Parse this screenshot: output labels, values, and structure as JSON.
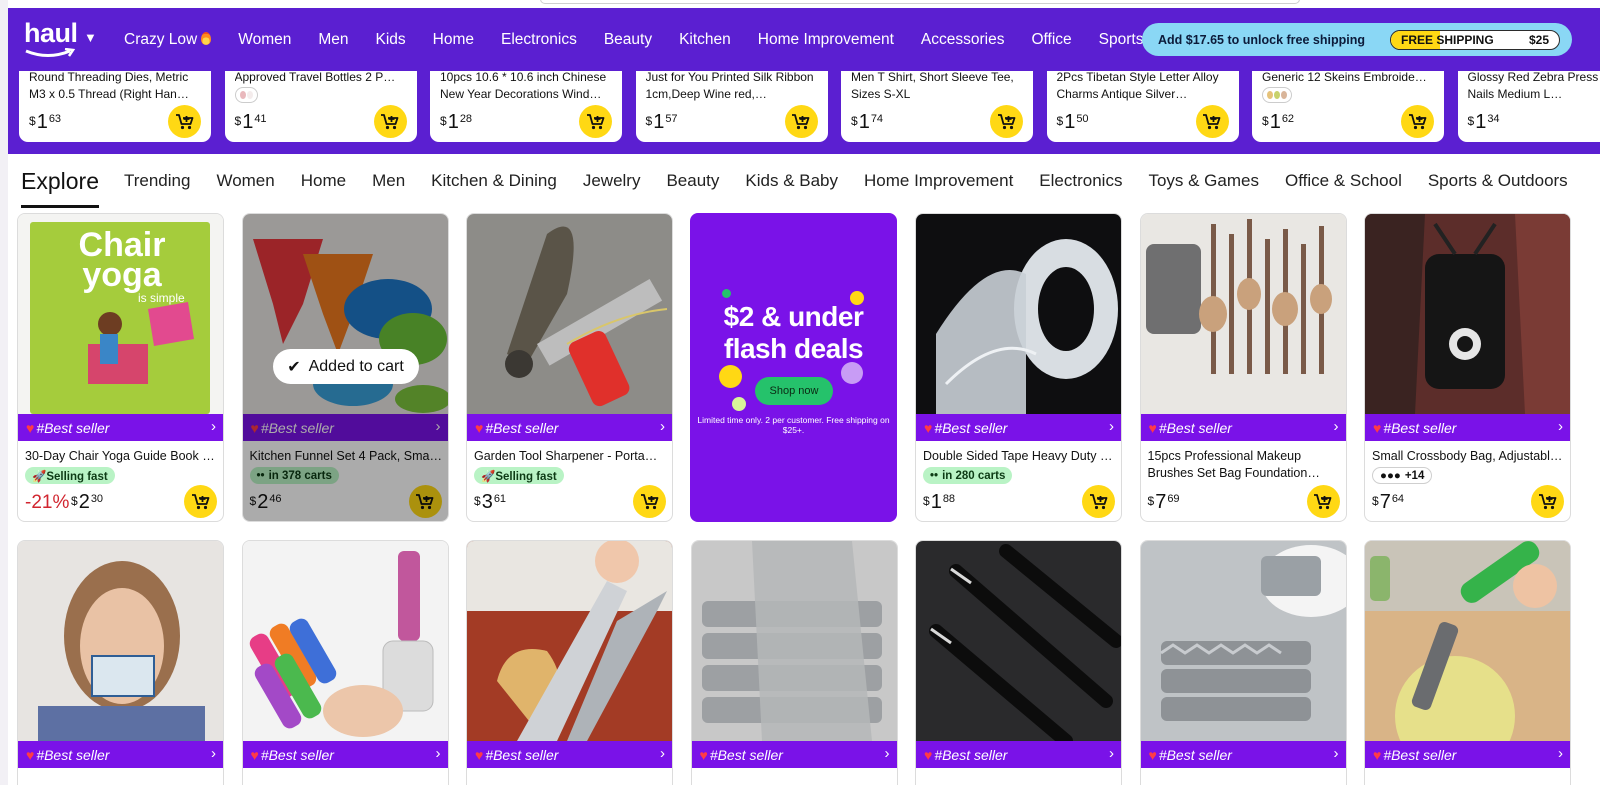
{
  "header": {
    "logo": "haul",
    "nav": [
      "Crazy Low",
      "Women",
      "Men",
      "Kids",
      "Home",
      "Electronics",
      "Beauty",
      "Kitchen",
      "Home Improvement",
      "Accessories",
      "Office",
      "Sports"
    ],
    "shipping": {
      "message": "Add $17.65 to unlock free shipping",
      "label": "FREE SHIPPING",
      "threshold": "$25",
      "progress_fraction": 0.29
    }
  },
  "carousel": [
    {
      "title": "Round Threading Dies, Metric M3 x 0.5 Thread (Right Han…",
      "dollars": "1",
      "cents": "63",
      "swatches": []
    },
    {
      "title": "Approved Travel Bottles 2 P…",
      "dollars": "1",
      "cents": "41",
      "swatches": [
        "#e9b8bc",
        "#f4ecec"
      ]
    },
    {
      "title": "10pcs 10.6 * 10.6 inch Chinese New Year Decorations Wind…",
      "dollars": "1",
      "cents": "28",
      "swatches": []
    },
    {
      "title": "Just for You Printed Silk Ribbon 1cm,Deep Wine red,…",
      "dollars": "1",
      "cents": "57",
      "swatches": []
    },
    {
      "title": "Men T Shirt, Short Sleeve Tee, Sizes S-XL",
      "dollars": "1",
      "cents": "74",
      "swatches": []
    },
    {
      "title": "2Pcs Tibetan Style Letter Alloy Charms Antique Silver…",
      "dollars": "1",
      "cents": "50",
      "swatches": []
    },
    {
      "title": "Generic 12 Skeins Embroide…",
      "dollars": "1",
      "cents": "62",
      "swatches": [
        "#e6c27a",
        "#c8d26b",
        "#d9b59a"
      ]
    },
    {
      "title": "Glossy Red Zebra Press on Nails Medium L…",
      "dollars": "1",
      "cents": "34",
      "swatches": []
    }
  ],
  "tabs": [
    "Explore",
    "Trending",
    "Women",
    "Home",
    "Men",
    "Kitchen & Dining",
    "Jewelry",
    "Beauty",
    "Kids & Baby",
    "Home Improvement",
    "Electronics",
    "Toys & Games",
    "Office & School",
    "Sports & Outdoors"
  ],
  "badge_label": "#Best seller",
  "products": [
    {
      "title": "30-Day Chair Yoga Guide Book …",
      "chip": "🚀Selling fast",
      "chip_type": "fast",
      "discount": "-21%",
      "dollars": "2",
      "cents": "30",
      "img": "book"
    },
    {
      "title": "Kitchen Funnel Set 4 Pack, Sma…",
      "chip": "in 378 carts",
      "chip_type": "carts",
      "discount": "",
      "dollars": "2",
      "cents": "46",
      "img": "funnels",
      "added": "Added to cart"
    },
    {
      "title": "Garden Tool Sharpener - Porta…",
      "chip": "🚀Selling fast",
      "chip_type": "fast",
      "discount": "",
      "dollars": "3",
      "cents": "61",
      "img": "sharpener"
    },
    {
      "title": "Double Sided Tape Heavy Duty …",
      "chip": "in 280 carts",
      "chip_type": "carts",
      "discount": "",
      "dollars": "1",
      "cents": "88",
      "img": "tape"
    },
    {
      "title": "15pcs Professional Makeup Brushes Set Bag Foundation…",
      "chip": "",
      "chip_type": "",
      "discount": "",
      "dollars": "7",
      "cents": "69",
      "img": "brushes"
    },
    {
      "title": "Small Crossbody Bag, Adjustabl…",
      "chip": "+14",
      "chip_type": "colors",
      "discount": "",
      "dollars": "7",
      "cents": "64",
      "img": "bag"
    }
  ],
  "promo": {
    "headline": "$2 & under flash deals",
    "button": "Shop now",
    "fine_print": "Limited time only. 2 per customer. Free shipping on $25+."
  },
  "row2": [
    {
      "img": "card-woman"
    },
    {
      "img": "perfume"
    },
    {
      "img": "shears"
    },
    {
      "img": "mesh-cloth"
    },
    {
      "img": "tweezers"
    },
    {
      "img": "cloth-sink"
    },
    {
      "img": "corer"
    }
  ],
  "colors": {
    "brand_purple": "#5b1fd1",
    "badge_purple": "#7a12e8",
    "cart_yellow": "#ffd814",
    "shipping_blue": "#8ad7f5",
    "discount_red": "#d1252f",
    "chip_green": "#b9f3c5"
  }
}
